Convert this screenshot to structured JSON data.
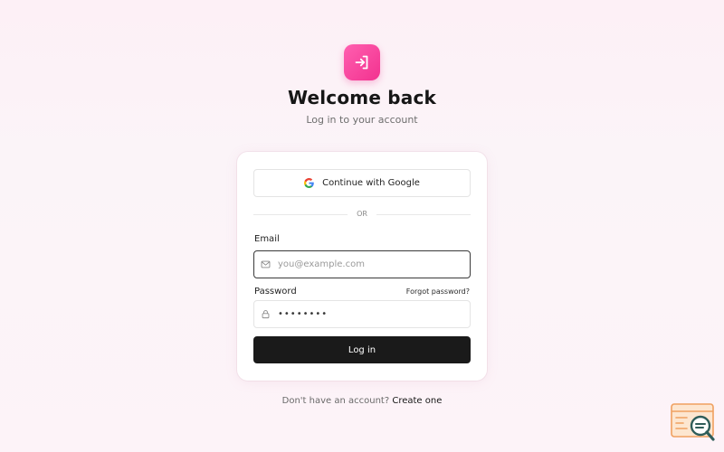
{
  "header": {
    "logo_icon": "login-arrow-icon",
    "title": "Welcome back",
    "subtitle": "Log in to your account"
  },
  "card": {
    "google_button": {
      "icon": "google-icon",
      "label": "Continue with Google"
    },
    "divider_text": "OR",
    "email": {
      "label": "Email",
      "icon": "mail-icon",
      "placeholder": "you@example.com",
      "value": ""
    },
    "password": {
      "label": "Password",
      "forgot_label": "Forgot password?",
      "icon": "lock-icon",
      "masked_value": "••••••••"
    },
    "submit_label": "Log in"
  },
  "footer": {
    "prompt": "Don't have an account?",
    "link": "Create one"
  },
  "colors": {
    "accent": "#f2328f",
    "button": "#1a1a1a",
    "background": "#fdf0f6"
  }
}
